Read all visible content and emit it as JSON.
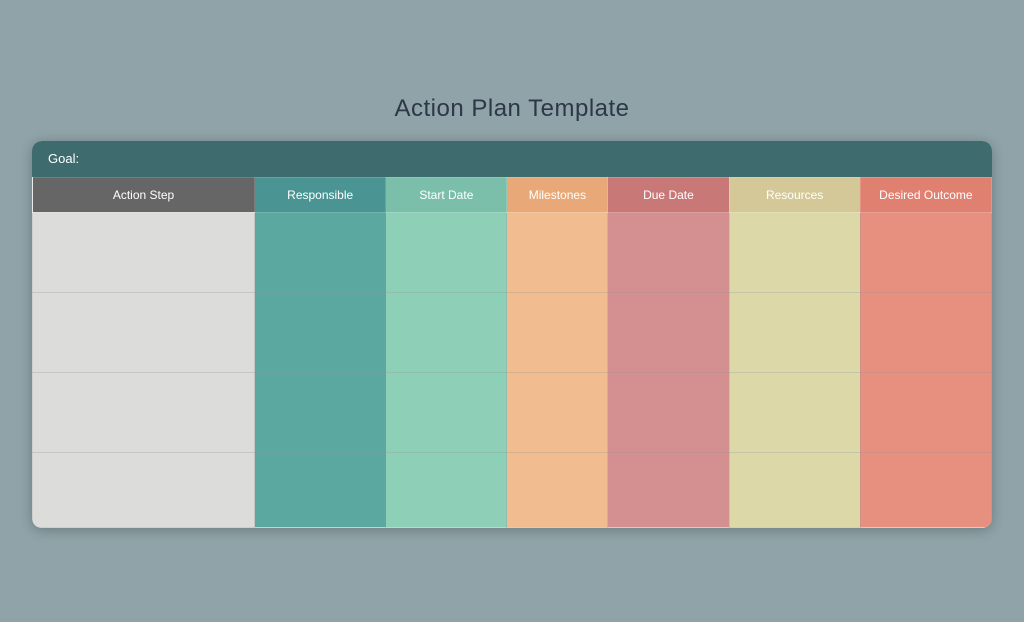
{
  "page": {
    "title": "Action Plan Template"
  },
  "goal_header": {
    "label": "Goal:"
  },
  "columns": [
    {
      "id": "action-step",
      "label": "Action Step"
    },
    {
      "id": "responsible",
      "label": "Responsible"
    },
    {
      "id": "start-date",
      "label": "Start Date"
    },
    {
      "id": "milestones",
      "label": "Milestones"
    },
    {
      "id": "due-date",
      "label": "Due Date"
    },
    {
      "id": "resources",
      "label": "Resources"
    },
    {
      "id": "desired-outcome",
      "label": "Desired Outcome"
    }
  ],
  "rows": [
    {
      "id": "row-1"
    },
    {
      "id": "row-2"
    },
    {
      "id": "row-3"
    },
    {
      "id": "row-4"
    }
  ]
}
